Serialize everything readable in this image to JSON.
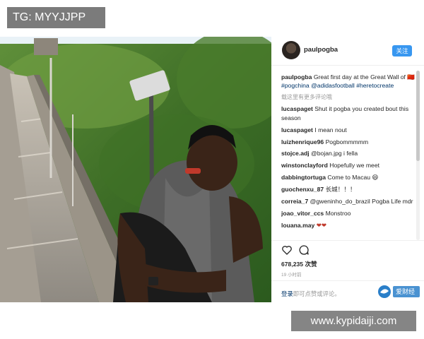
{
  "watermark_tag": "TG: MYYJJPP",
  "site_watermark": "www.kypidaiji.com",
  "post": {
    "username": "paulpogba",
    "follow_label": "关注",
    "caption": {
      "user": "paulpogba",
      "text": "Great first day at the Great Wall of 🇨🇳",
      "tags": [
        "#pogchina",
        "@adidasfootball",
        "#heretocreate"
      ]
    },
    "more_comments": "载这里有更多评论哦",
    "comments": [
      {
        "user": "lucaspaget",
        "text": "Shut it pogba you created bout this season"
      },
      {
        "user": "lucaspaget",
        "text": "I mean nout"
      },
      {
        "user": "luizhenrique96",
        "text": "Pogbommmmm"
      },
      {
        "user": "stojce.adj",
        "text": "@bojan.jpg i fella"
      },
      {
        "user": "winstonclayford",
        "text": "Hopefully we meet"
      },
      {
        "user": "dabbingtortuga",
        "text": "Come to Macau 😄"
      },
      {
        "user": "guochenxu_87",
        "text": "长城！！！"
      },
      {
        "user": "correia_7",
        "text": "@gweninho_do_brazil Pogba Life mdr"
      },
      {
        "user": "joao_vitor_ccs",
        "text": "Monstroo"
      },
      {
        "user": "louana.may",
        "text": "❤❤"
      }
    ],
    "likes": "678,235 次赞",
    "time": "19 小时前",
    "login_link": "登录",
    "login_rest": "即可点赞或评论。"
  },
  "logo_text": "爱财经"
}
